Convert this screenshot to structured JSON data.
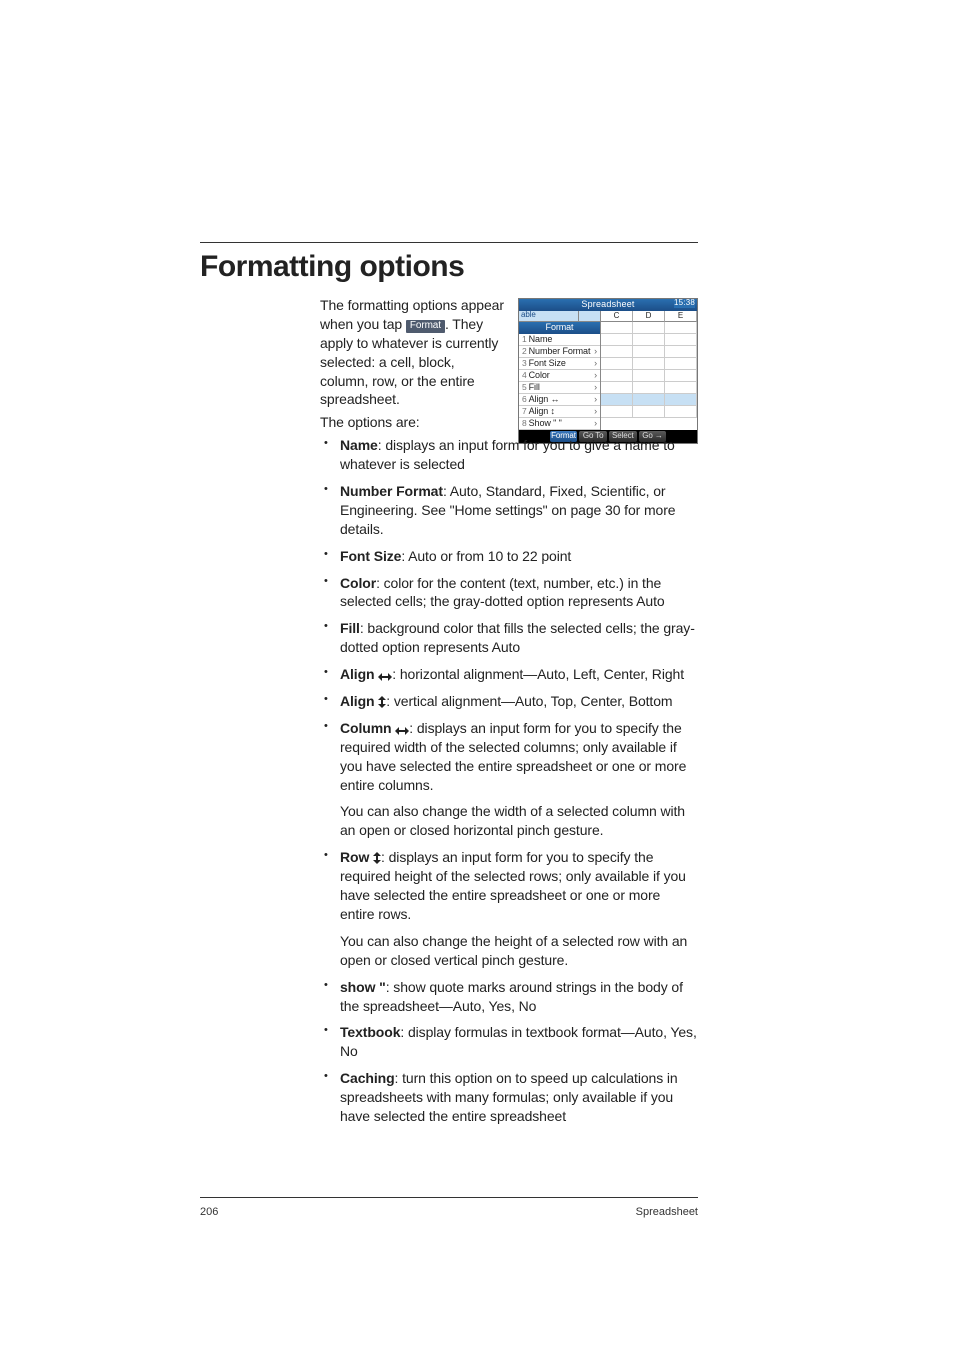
{
  "heading": "Formatting options",
  "intro": {
    "p1a": "The formatting options appear when you tap ",
    "btn": "Format",
    "p1b": ". They apply to whatever is currently selected: a cell, block, column, row, or the entire spreadsheet.",
    "p2": "The options are:"
  },
  "items": {
    "name": {
      "label": "Name",
      "text": ": displays an input form for you to give a name to whatever is selected"
    },
    "numfmt": {
      "label": "Number Format",
      "text": ": Auto, Standard, Fixed, Scientific, or Engineering. See \"Home settings\" on page 30 for more details."
    },
    "fontsize": {
      "label": "Font Size",
      "text": ": Auto or from 10 to 22 point"
    },
    "color": {
      "label": "Color",
      "text": ": color for the content (text, number, etc.) in the selected cells; the gray-dotted option represents Auto"
    },
    "fill": {
      "label": "Fill",
      "text": ": background color that fills the selected cells; the gray-dotted option represents Auto"
    },
    "alignh": {
      "label": "Align ",
      "text": ": horizontal alignment—Auto, Left, Center, Right"
    },
    "alignv": {
      "label": "Align ",
      "text": ": vertical alignment—Auto, Top, Center, Bottom"
    },
    "column": {
      "label": "Column ",
      "text": ": displays an input form for you to specify the required width of the selected columns; only available if you have selected the entire spreadsheet or one or more entire columns.",
      "p2": "You can also change the width of a selected column with an open or closed horizontal pinch gesture."
    },
    "row": {
      "label": "Row ",
      "text": ": displays an input form for you to specify the required height of the selected rows; only available if you have selected the entire spreadsheet or one or more entire rows.",
      "p2": "You can also change the height of a selected row with an open or closed vertical pinch gesture."
    },
    "show": {
      "label": "show \"",
      "text": ": show quote marks around strings in the body of the spreadsheet—Auto, Yes, No"
    },
    "textbook": {
      "label": "Textbook",
      "text": ": display formulas in textbook format—Auto, Yes, No"
    },
    "caching": {
      "label": "Caching",
      "text": ": turn this option on to speed up calculations in spreadsheets with many formulas; only available if you have selected the entire spreadsheet"
    }
  },
  "footer": {
    "page": "206",
    "chapter": "Spreadsheet"
  },
  "shot": {
    "title": "Spreadsheet",
    "time": "15:38",
    "hdr_app": "able",
    "cols": [
      "C",
      "D",
      "E"
    ],
    "menu_title": "Format",
    "menu": [
      {
        "n": "1",
        "t": "Name",
        "a": ""
      },
      {
        "n": "2",
        "t": "Number Format",
        "a": "›"
      },
      {
        "n": "3",
        "t": "Font Size",
        "a": "›"
      },
      {
        "n": "4",
        "t": "Color",
        "a": "›"
      },
      {
        "n": "5",
        "t": "Fill",
        "a": "›"
      },
      {
        "n": "6",
        "t": "Align ↔",
        "a": "›"
      },
      {
        "n": "7",
        "t": "Align ↕",
        "a": "›"
      },
      {
        "n": "8",
        "t": "Show \" \"",
        "a": "›"
      }
    ],
    "softkeys": [
      "",
      "Format",
      "Go To",
      "Select",
      "Go →",
      ""
    ]
  }
}
